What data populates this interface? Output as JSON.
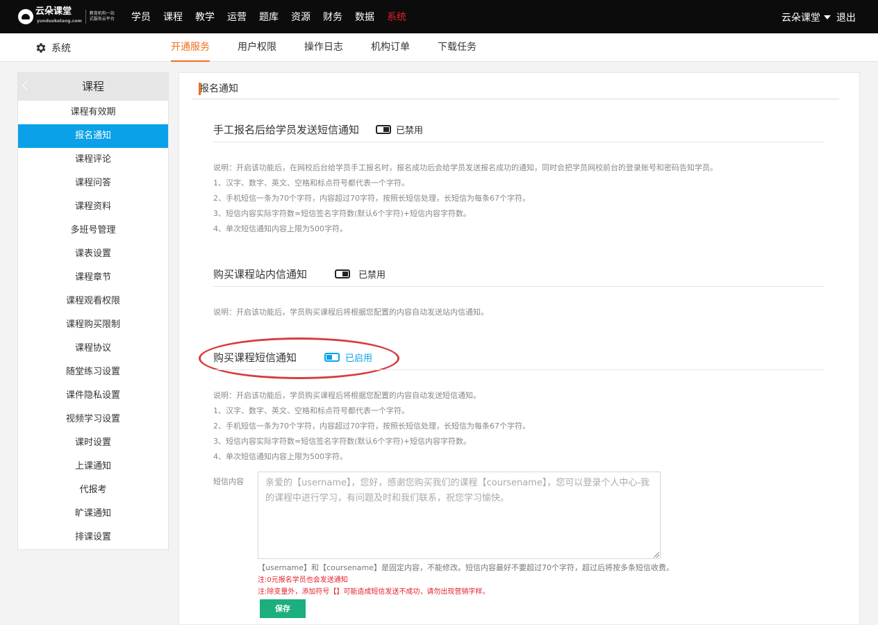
{
  "brand": {
    "name": "云朵课堂",
    "domain": "yunduoketang.com",
    "slogan": "教育机构一站式服务云平台"
  },
  "topnav": {
    "items": [
      "学员",
      "课程",
      "教学",
      "运营",
      "题库",
      "资源",
      "财务",
      "数据",
      "系统"
    ],
    "active_index": 8
  },
  "user": {
    "name": "云朵课堂",
    "logout": "退出"
  },
  "subnav": {
    "section": "系统",
    "tabs": [
      "开通服务",
      "用户权限",
      "操作日志",
      "机构订单",
      "下载任务"
    ],
    "active_index": 0
  },
  "sidebar": {
    "title": "课程",
    "active_index": 1,
    "items": [
      "课程有效期",
      "报名通知",
      "课程评论",
      "课程问答",
      "课程资料",
      "多班号管理",
      "课表设置",
      "课程章节",
      "课程观看权限",
      "课程购买限制",
      "课程协议",
      "随堂练习设置",
      "课件隐私设置",
      "视频学习设置",
      "课时设置",
      "上课通知",
      "代报考",
      "旷课通知",
      "排课设置"
    ]
  },
  "panel": {
    "title": "报名通知"
  },
  "sections": [
    {
      "title": "手工报名后给学员发送短信通知",
      "status": "已禁用",
      "enabled": false,
      "desc": [
        "说明：开启该功能后，在网校后台给学员手工报名时，报名成功后会给学员发送报名成功的通知，同时会把学员网校前台的登录账号和密码告知学员。",
        "1、汉字、数字、英文、空格和标点符号都代表一个字符。",
        "2、手机短信一条为70个字符，内容超过70字符，按照长短信处理，长短信为每条67个字符。",
        "3、短信内容实际字符数=短信签名字符数(默认6个字符)+短信内容字符数。",
        "4、单次短信通知内容上限为500字符。"
      ]
    },
    {
      "title": "购买课程站内信通知",
      "status": "已禁用",
      "enabled": false,
      "desc": [
        "说明：开启该功能后，学员购买课程后将根据您配置的内容自动发送站内信通知。"
      ]
    },
    {
      "title": "购买课程短信通知",
      "status": "已启用",
      "enabled": true,
      "desc": [
        "说明：开启该功能后，学员购买课程后将根据您配置的内容自动发送短信通知。",
        "1、汉字、数字、英文、空格和标点符号都代表一个字符。",
        "2、手机短信一条为70个字符，内容超过70字符，按照长短信处理，长短信为每条67个字符。",
        "3、短信内容实际字符数=短信签名字符数(默认6个字符)+短信内容字符数。",
        "4、单次短信通知内容上限为500字符。"
      ]
    }
  ],
  "sms": {
    "label": "短信内容",
    "content": "亲爱的【username】，您好，感谢您购买我们的课程【coursename】，您可以登录个人中心-我的课程中进行学习，有问题及时和我们联系，祝您学习愉快。",
    "note": "【username】和【coursename】是固定内容，不能修改。短信内容最好不要超过70个字符，超过后将按多条短信收费。",
    "warn1": "注:0元报名学员也会发送通知",
    "warn2": "注:除变量外，添加符号【】可能造成短信发送不成功，请勿出现营销字样。",
    "save_label": "保存"
  }
}
